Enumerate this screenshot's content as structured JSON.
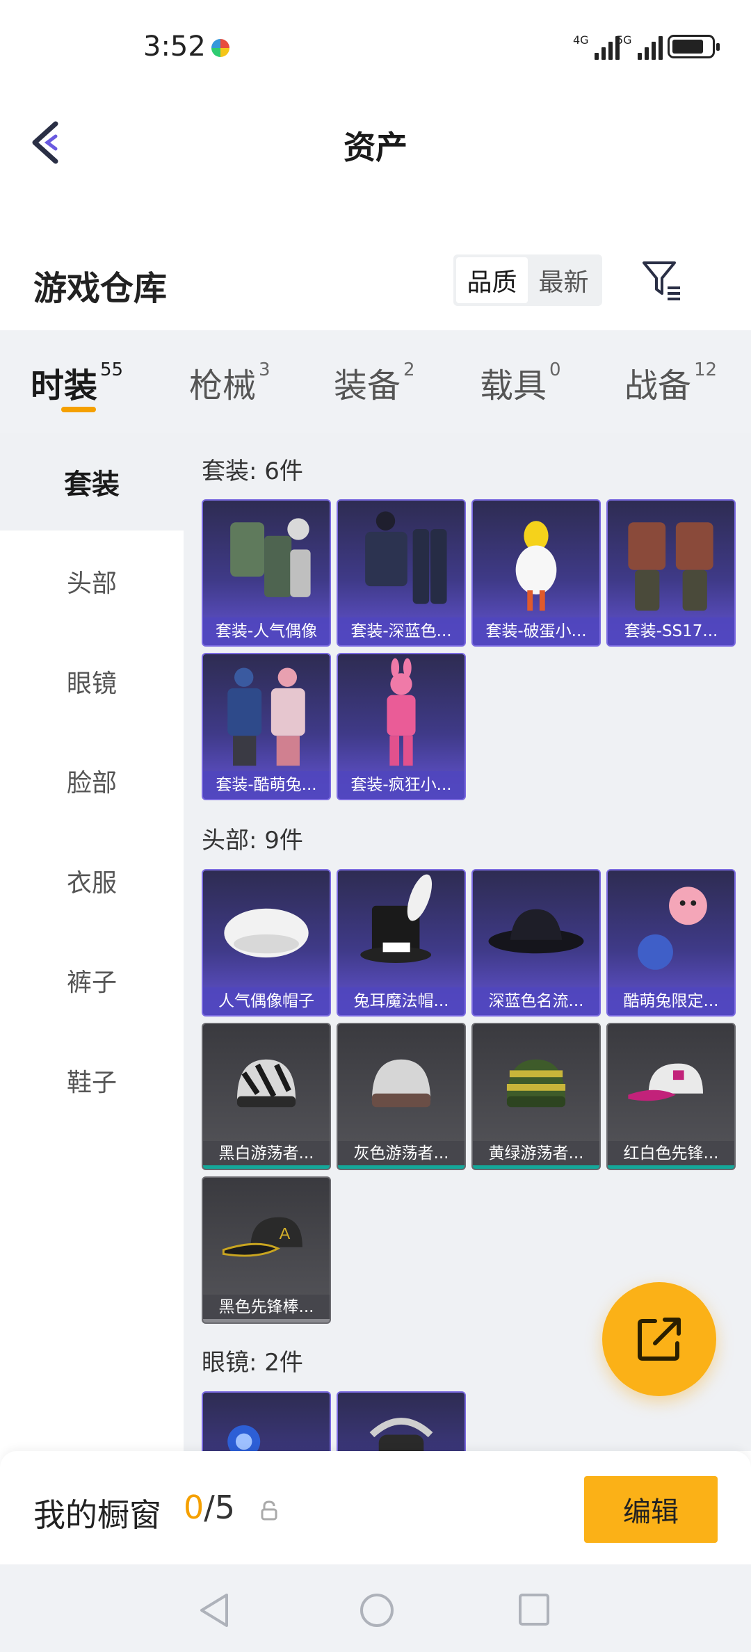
{
  "status_bar": {
    "time": "3:52",
    "network_1": "4G",
    "network_2": "5G"
  },
  "nav": {
    "title": "资产"
  },
  "warehouse": {
    "title": "游戏仓库",
    "sort_options": [
      "品质",
      "最新"
    ],
    "sort_selected": "品质"
  },
  "tabs": [
    {
      "label": "时装",
      "count": "55",
      "active": true
    },
    {
      "label": "枪械",
      "count": "3"
    },
    {
      "label": "装备",
      "count": "2"
    },
    {
      "label": "载具",
      "count": "0"
    },
    {
      "label": "战备",
      "count": "12"
    }
  ],
  "sidebar": {
    "items": [
      "套装",
      "头部",
      "眼镜",
      "脸部",
      "衣服",
      "裤子",
      "鞋子"
    ],
    "active": "套装"
  },
  "sections": [
    {
      "title": "套装: 6件",
      "items": [
        {
          "name": "套装-人气偶像",
          "rarity": "purple",
          "icon": "outfit-icon"
        },
        {
          "name": "套装-深蓝色...",
          "rarity": "purple",
          "icon": "suit-icon"
        },
        {
          "name": "套装-破蛋小...",
          "rarity": "purple",
          "icon": "chick-costume-icon"
        },
        {
          "name": "套装-SS17...",
          "rarity": "purple",
          "icon": "outfit-icon"
        },
        {
          "name": "套装-酷萌兔...",
          "rarity": "purple",
          "icon": "outfit-icon"
        },
        {
          "name": "套装-疯狂小...",
          "rarity": "purple",
          "icon": "bunny-costume-icon"
        }
      ]
    },
    {
      "title": "头部: 9件",
      "items": [
        {
          "name": "人气偶像帽子",
          "rarity": "purple",
          "icon": "beret-icon"
        },
        {
          "name": "兔耳魔法帽...",
          "rarity": "purple",
          "icon": "bunny-top-hat-icon"
        },
        {
          "name": "深蓝色名流...",
          "rarity": "purple",
          "icon": "fedora-icon"
        },
        {
          "name": "酷萌兔限定...",
          "rarity": "purple",
          "icon": "bunny-hat-icon"
        },
        {
          "name": "黑白游荡者...",
          "rarity": "grey",
          "icon": "beanie-icon"
        },
        {
          "name": "灰色游荡者...",
          "rarity": "grey",
          "icon": "beanie-icon"
        },
        {
          "name": "黄绿游荡者...",
          "rarity": "grey",
          "icon": "beanie-icon"
        },
        {
          "name": "红白色先锋...",
          "rarity": "grey",
          "icon": "cap-icon"
        },
        {
          "name": "黑色先锋棒...",
          "rarity": "grey-plain",
          "icon": "cap-icon"
        }
      ]
    },
    {
      "title": "眼镜: 2件",
      "items": [
        {
          "name": "",
          "rarity": "purple",
          "icon": "goggles-icon"
        },
        {
          "name": "",
          "rarity": "purple",
          "icon": "goggles-icon"
        }
      ]
    }
  ],
  "showcase": {
    "label": "我的橱窗",
    "current": "0",
    "total": "/5",
    "edit_label": "编辑"
  },
  "colors": {
    "accent": "#f5a000",
    "rare_purple": "#6555d6",
    "common_grey": "#55555a"
  }
}
